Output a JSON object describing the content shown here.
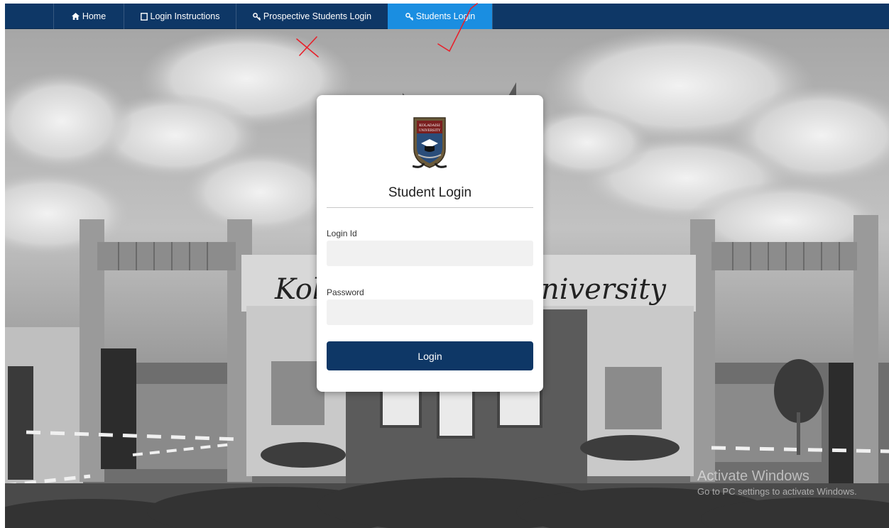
{
  "nav": {
    "items": [
      {
        "label": "Home",
        "icon": "home-icon",
        "active": false
      },
      {
        "label": "Login Instructions",
        "icon": "document-icon",
        "active": false
      },
      {
        "label": "Prospective Students Login",
        "icon": "key-icon",
        "active": false
      },
      {
        "label": "Students Login",
        "icon": "key-icon",
        "active": true
      }
    ]
  },
  "background": {
    "gate_sign_left": "Kol",
    "gate_sign_right": "niversity"
  },
  "login": {
    "crest_text_line1": "KOLADAISI",
    "crest_text_line2": "UNIVERSITY",
    "title": "Student Login",
    "login_id_label": "Login Id",
    "login_id_value": "",
    "password_label": "Password",
    "password_value": "",
    "submit_label": "Login"
  },
  "watermark": {
    "title": "Activate Windows",
    "subtitle": "Go to PC settings to activate Windows."
  },
  "colors": {
    "nav_bg": "#0e3766",
    "nav_active": "#1a8ee1",
    "button_bg": "#0e3766",
    "annotation_red": "#e8202a"
  }
}
